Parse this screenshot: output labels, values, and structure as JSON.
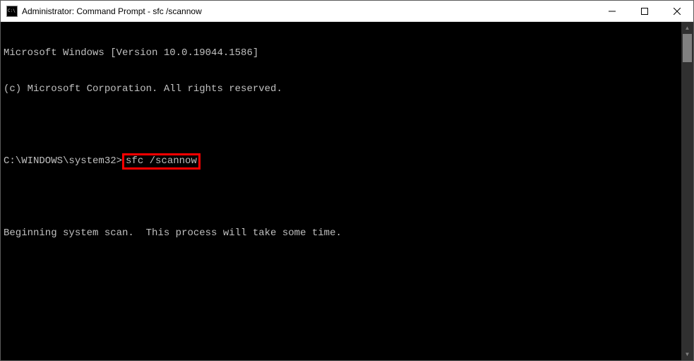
{
  "window": {
    "title": "Administrator: Command Prompt - sfc  /scannow"
  },
  "terminal": {
    "line1": "Microsoft Windows [Version 10.0.19044.1586]",
    "line2": "(c) Microsoft Corporation. All rights reserved.",
    "blank1": "",
    "prompt_prefix": "C:\\WINDOWS\\system32>",
    "command": "sfc /scannow",
    "blank2": "",
    "status": "Beginning system scan.  This process will take some time."
  }
}
